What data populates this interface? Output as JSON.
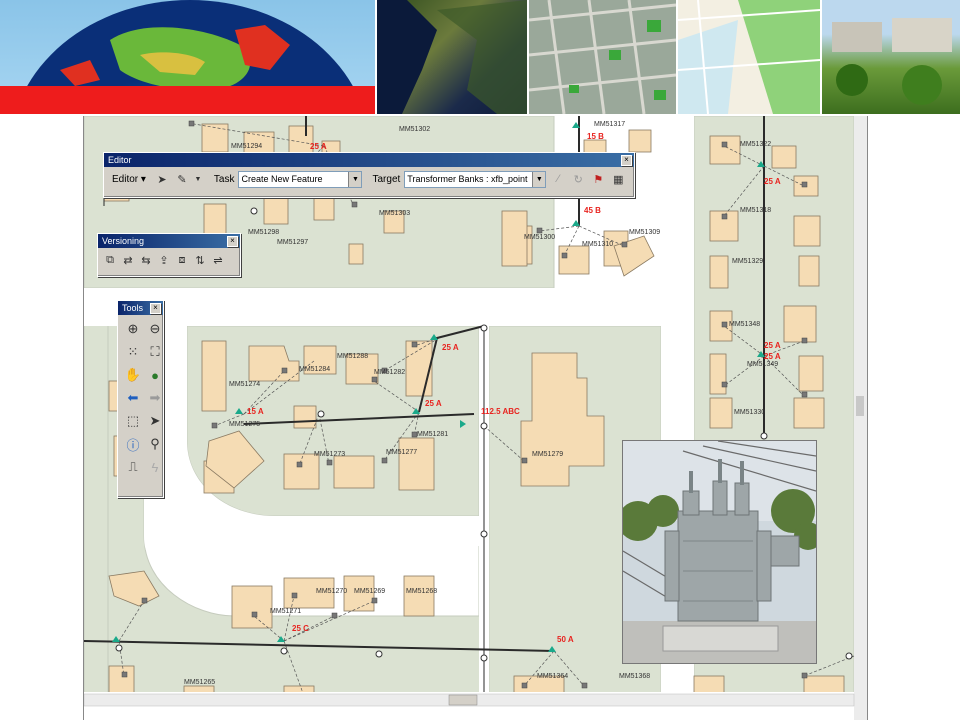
{
  "banner": {
    "images": [
      "earth-globe-icon",
      "satellite-terrain-icon",
      "city-aerial-icon",
      "street-map-icon",
      "3d-city-icon"
    ]
  },
  "editor": {
    "title": "Editor",
    "menu_label": "Editor ▾",
    "task_label": "Task",
    "task_value": "Create New Feature",
    "target_label": "Target",
    "target_value": "Transformer Banks : xfb_point"
  },
  "versioning": {
    "title": "Versioning"
  },
  "tools": {
    "title": "Tools"
  },
  "map": {
    "parcel_labels": [
      "MM51294",
      "MM51302",
      "MM51317",
      "MM51322",
      "MM51298",
      "MM51303",
      "MM51297",
      "MM51300",
      "MM51310",
      "MM51309",
      "MM51318",
      "MM51329",
      "MM51274",
      "MM51284",
      "MM51288",
      "MM51282",
      "MM51275",
      "MM51273",
      "MM51281",
      "MM51277",
      "MM51279",
      "MM51348",
      "MM51349",
      "MM51330",
      "MM51270",
      "MM51269",
      "MM51268",
      "MM51271",
      "MM51265",
      "MM51364",
      "MM51368"
    ],
    "load_labels": [
      "25 A",
      "15 B",
      "45 B",
      "25 A",
      "25 A",
      "25 A",
      "15 A",
      "25 A",
      "112.5 ABC",
      "25 A",
      "25 C",
      "50 A"
    ]
  },
  "colors": {
    "parcel": "#f5dcb4",
    "block": "#dbe2d2",
    "road": "#ffffff",
    "line": "#333333",
    "load": "#e8231f",
    "device": "#1aa98a"
  }
}
